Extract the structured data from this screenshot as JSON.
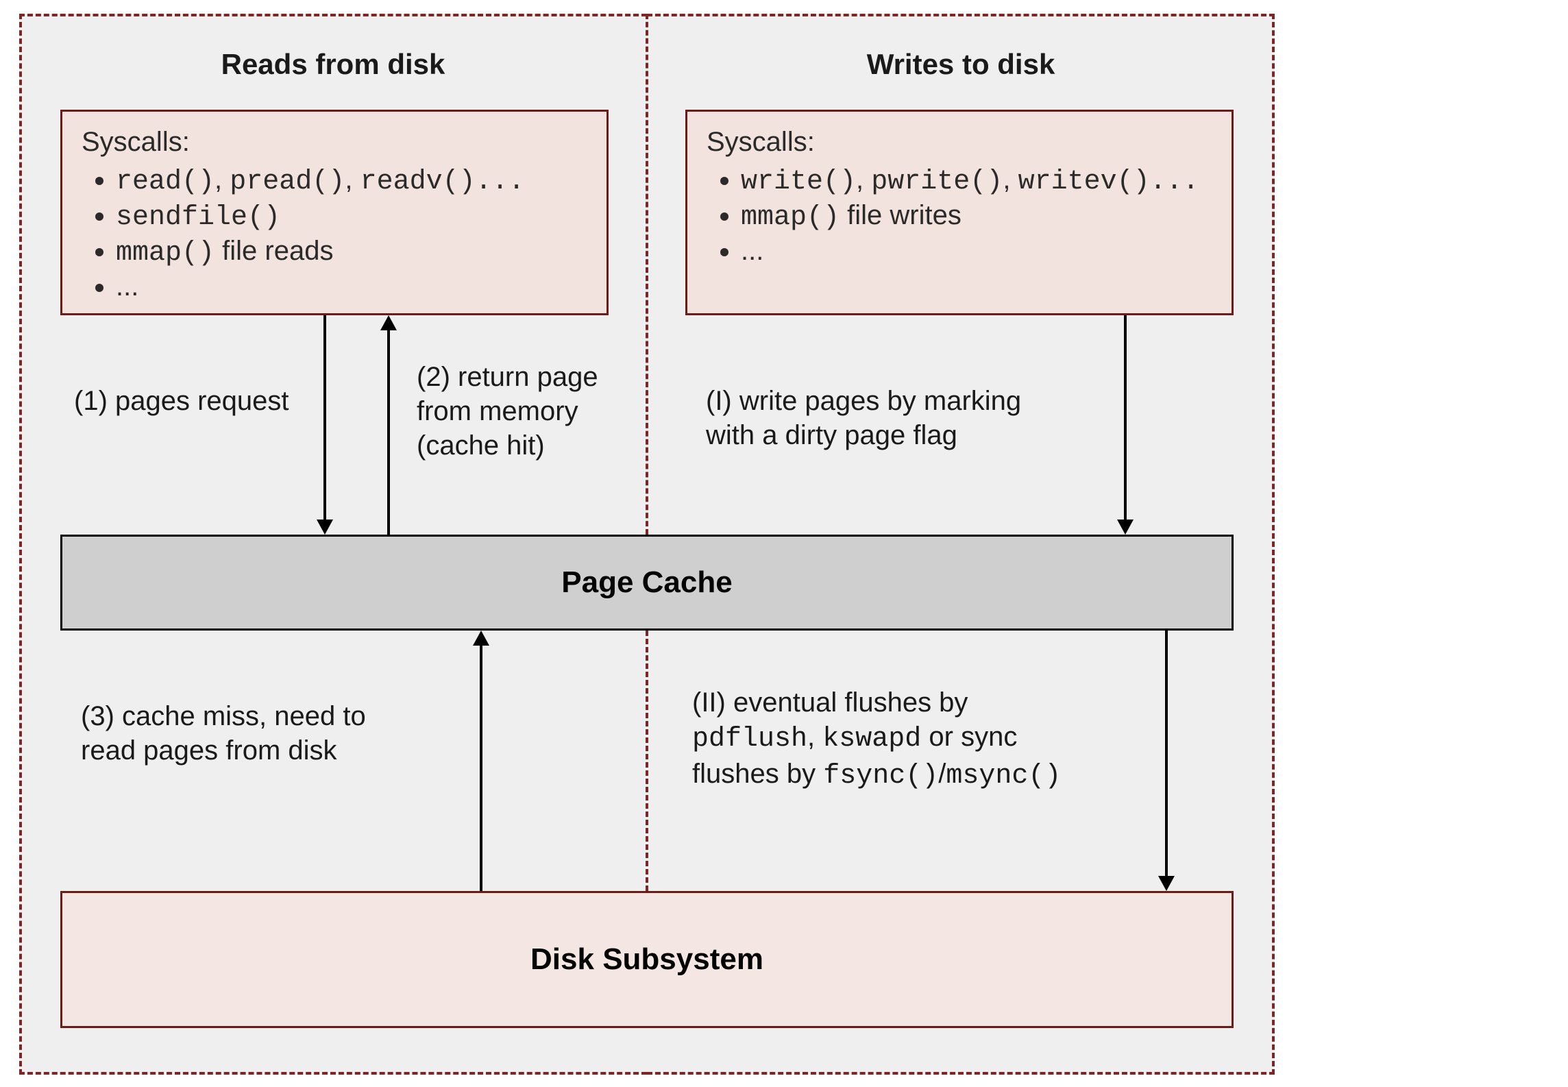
{
  "left_panel": {
    "title": "Reads from disk",
    "box": {
      "label": "Syscalls:",
      "item1_code": "read()",
      "item1_c2": "pread()",
      "item1_c3": "readv()",
      "item1_tail": "...",
      "item2_code": "sendfile()",
      "item3_code": "mmap()",
      "item3_tail": " file reads",
      "item4": "..."
    },
    "annot1": "(1) pages request",
    "annot2": "(2) return page\nfrom memory\n(cache hit)",
    "annot3": "(3) cache miss, need to\nread pages from disk"
  },
  "right_panel": {
    "title": "Writes to disk",
    "box": {
      "label": "Syscalls:",
      "item1_code": "write()",
      "item1_c2": "pwrite()",
      "item1_c3": "writev()",
      "item1_tail": "...",
      "item2_code": "mmap()",
      "item2_tail": " file writes",
      "item3": "..."
    },
    "annotI": "(I) write pages by marking\nwith a dirty page flag",
    "annotII_pre": "(II) eventual flushes by",
    "annotII_c1": "pdflush",
    "annotII_mid1": ", ",
    "annotII_c2": "kswapd",
    "annotII_mid2": " or sync",
    "annotII_line3a": "flushes by ",
    "annotII_c3": "fsync()",
    "annotII_slash": "/",
    "annotII_c4": "msync()"
  },
  "page_cache": "Page Cache",
  "disk_subsystem": "Disk Subsystem"
}
